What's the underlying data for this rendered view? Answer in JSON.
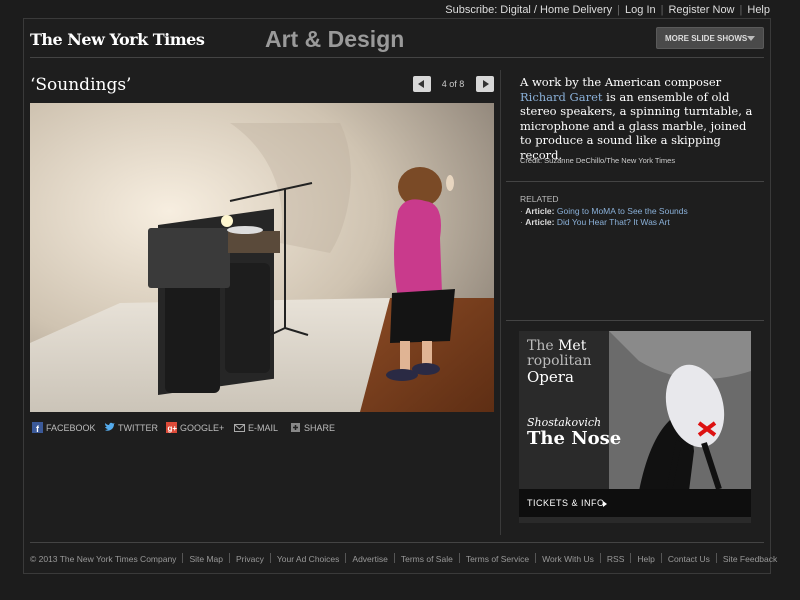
{
  "top_links": {
    "subscribe": "Subscribe: Digital / Home Delivery",
    "login": "Log In",
    "register": "Register Now",
    "help": "Help"
  },
  "masthead": {
    "logo": "The New York Times",
    "section": "Art & Design",
    "more_button": "MORE SLIDE SHOWS"
  },
  "slide": {
    "title": "‘Soundings’",
    "counter": "4 of 8"
  },
  "caption": {
    "text_before": "A work by the American composer ",
    "link": "Richard Garet",
    "text_after": " is an ensemble of old stereo speakers, a spinning turntable, a microphone and a glass marble, joined to produce a sound like a skipping record.",
    "credit": "Credit: Suzanne DeChillo/The New York Times"
  },
  "related": {
    "heading": "RELATED",
    "items": [
      {
        "kind": "Article:",
        "title": "Going to MoMA to See the Sounds"
      },
      {
        "kind": "Article:",
        "title": "Did You Hear That? It Was Art"
      }
    ]
  },
  "share": {
    "facebook": "FACEBOOK",
    "twitter": "TWITTER",
    "google": "GOOGLE+",
    "email": "E-MAIL",
    "share": "SHARE"
  },
  "ad": {
    "the": "The",
    "met": "Met",
    "ropolitan": "ropolitan",
    "opera": "Opera",
    "composer": "Shostakovich",
    "title": "The Nose",
    "cta": "TICKETS & INFO"
  },
  "footer": {
    "links": [
      "© 2013 The New York Times Company",
      "Site Map",
      "Privacy",
      "Your Ad Choices",
      "Advertise",
      "Terms of Sale",
      "Terms of Service",
      "Work With Us",
      "RSS",
      "Help",
      "Contact Us",
      "Site Feedback"
    ]
  },
  "colors": {
    "background": "#1c1c1c",
    "link": "#8ab0d8",
    "facebook": "#3b5998",
    "twitter": "#55acee",
    "google": "#dd4b39"
  }
}
